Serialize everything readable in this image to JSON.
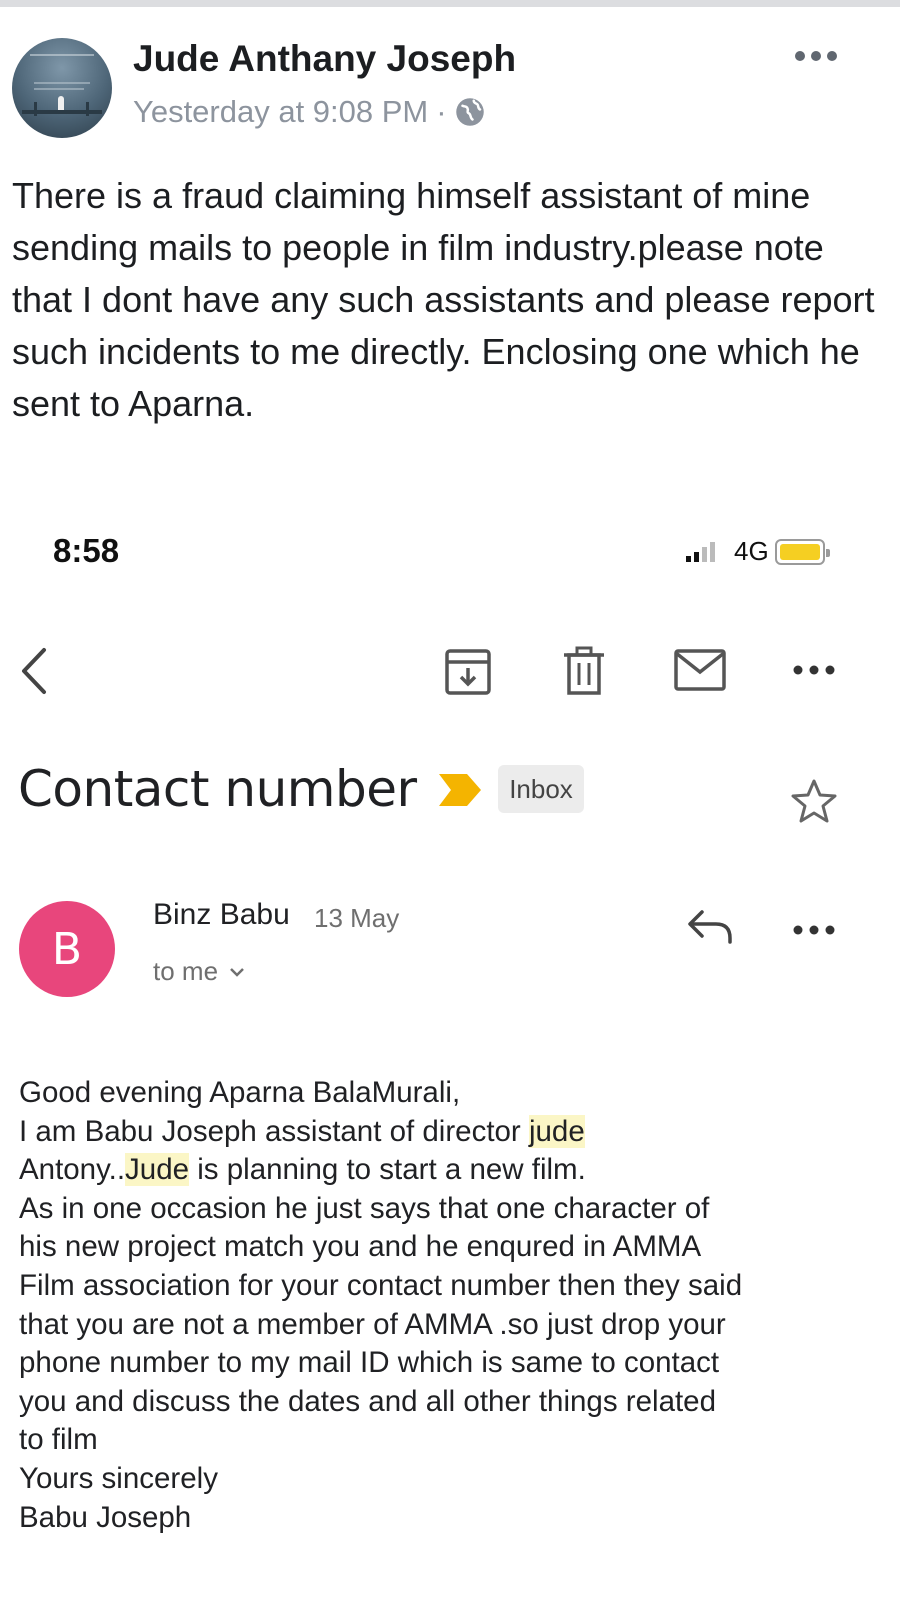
{
  "post": {
    "author": "Jude Anthany Joseph",
    "timestamp": "Yesterday at 9:08 PM",
    "separator": "·",
    "privacy_icon": "globe-icon",
    "more_icon": "more-horizontal-icon",
    "text": "There is a fraud claiming himself assistant of mine sending mails to people in film industry.please note that I dont have any such assistants and please report such incidents to me directly. Enclosing one which he sent to Aparna."
  },
  "phone_status": {
    "time": "8:58",
    "network": "4G",
    "battery_color": "#f5cf22"
  },
  "mail_toolbar": {
    "icons": [
      "back-icon",
      "archive-icon",
      "delete-icon",
      "mark-unread-icon",
      "more-horizontal-icon"
    ]
  },
  "email": {
    "subject": "Contact number",
    "label": "Inbox",
    "importance_color": "#f4b400",
    "sender_initial": "B",
    "sender_avatar_color": "#e8467c",
    "sender": "Binz Babu",
    "date": "13 May",
    "recipient": "to me",
    "body": {
      "line1": "Good evening Aparna BalaMurali,",
      "line2a": "I am Babu Joseph assistant of director ",
      "line2b": "jude",
      "line3a": "Antony..",
      "line3b": "Jude",
      "line3c": " is planning to start a new film.",
      "rest": " As in one occasion he just says that one character of\nhis new project match you and he enqured in AMMA\nFilm association for your contact number then they said\nthat you are not a member of AMMA .so just drop your\nphone number to my mail ID which is same to contact\nyou and discuss the dates and all other things related\nto film\nYours sincerely\nBabu Joseph"
    }
  }
}
